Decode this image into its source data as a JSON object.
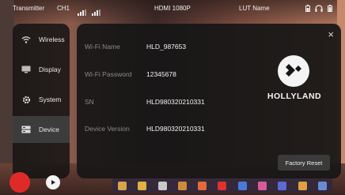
{
  "status_bar": {
    "mode": "Transmitter",
    "channel": "CH1",
    "hdmi": "HDMI 1080P",
    "lut": "LUT Name"
  },
  "menu": {
    "items": [
      {
        "label": "Wireless",
        "icon": "wifi-icon"
      },
      {
        "label": "Display",
        "icon": "monitor-icon"
      },
      {
        "label": "System",
        "icon": "gear-icon"
      },
      {
        "label": "Device",
        "icon": "device-icon",
        "active": true
      }
    ]
  },
  "panel": {
    "close_glyph": "×",
    "fields": [
      {
        "label": "Wi-Fi Name",
        "value": "HLD_987653"
      },
      {
        "label": "Wi-Fi Password",
        "value": "12345678"
      },
      {
        "label": "SN",
        "value": "HLD980320210331"
      },
      {
        "label": "Device Version",
        "value": "HLD980320210331"
      }
    ],
    "brand": "HOLLYLAND",
    "factory_reset": "Factory Reset"
  },
  "colors": {
    "record": "#e02a2a",
    "panel_bg": "#161616",
    "active_item": "#3c3c3c"
  }
}
